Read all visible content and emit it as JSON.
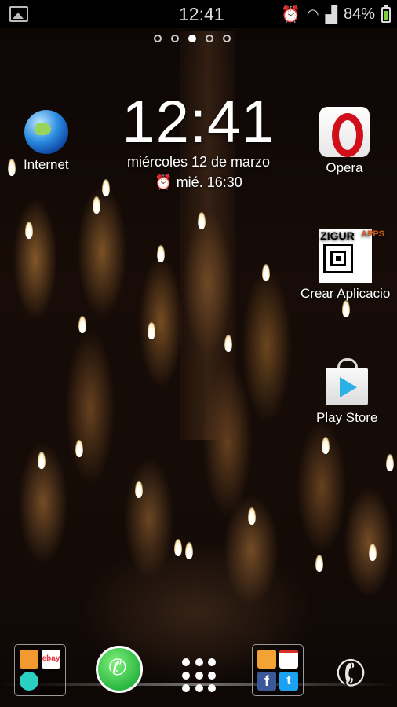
{
  "status_bar": {
    "time": "12:41",
    "battery_percent": "84%",
    "icons": [
      "image-notification-icon",
      "alarm-icon",
      "wifi-icon",
      "signal-icon",
      "battery-icon"
    ]
  },
  "pager": {
    "pages": 5,
    "active_index": 2
  },
  "clock_widget": {
    "time": "12:41",
    "date": "miércoles 12 de marzo",
    "alarm": "mié. 16:30"
  },
  "apps": {
    "internet": "Internet",
    "opera": "Opera",
    "zigur": "Crear Aplicacio",
    "zigur_logo": "ZIGUR",
    "zigur_side": "APPS",
    "play_store": "Play Store"
  },
  "dock": {
    "folder1_icons": [
      "box-app-icon",
      "ebay-icon",
      "cloud-app-icon"
    ],
    "folder1_ebay": "ebay",
    "center": "whatsapp-icon",
    "folder2_icons": [
      "slideshow-app-icon",
      "gmail-icon",
      "facebook-icon",
      "twitter-icon"
    ],
    "folder2_fb": "f",
    "folder2_tw": "t"
  }
}
